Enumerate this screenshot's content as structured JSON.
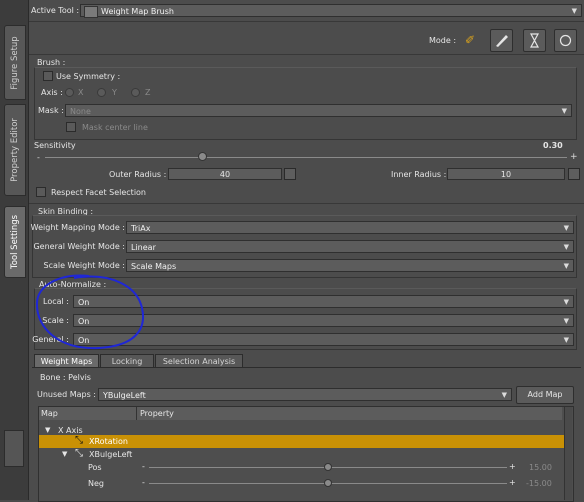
{
  "side_tabs": [
    {
      "label": "Figure Setup"
    },
    {
      "label": "Property Editor"
    },
    {
      "label": "Tool Settings"
    }
  ],
  "header": {
    "active_tool_label": "Active Tool :",
    "tool_name": "Weight Map Brush",
    "mode_label": "Mode :"
  },
  "brush": {
    "section_label": "Brush :",
    "use_symmetry_label": "Use Symmetry :",
    "axis_label": "Axis :",
    "axis_options": [
      "X",
      "Y",
      "Z"
    ],
    "mask_label": "Mask :",
    "mask_value": "None",
    "mask_center_line_label": "Mask center line"
  },
  "sensitivity": {
    "label": "Sensitivity",
    "value": "0.30",
    "level": 0.3
  },
  "radius": {
    "outer_label": "Outer Radius :",
    "outer_value": "40",
    "inner_label": "Inner Radius :",
    "inner_value": "10"
  },
  "respect_facet_label": "Respect Facet Selection",
  "skin_binding": {
    "section_label": "Skin Binding :",
    "rows": [
      {
        "label": "Weight Mapping Mode :",
        "value": "TriAx"
      },
      {
        "label": "General Weight Mode :",
        "value": "Linear"
      },
      {
        "label": "Scale Weight Mode :",
        "value": "Scale Maps"
      }
    ]
  },
  "auto_normalize": {
    "section_label": "Auto-Normalize :",
    "rows": [
      {
        "label": "Local :",
        "value": "On"
      },
      {
        "label": "Scale :",
        "value": "On"
      },
      {
        "label": "General :",
        "value": "On"
      }
    ]
  },
  "tabs": [
    "Weight Maps",
    "Locking",
    "Selection Analysis"
  ],
  "bone_label": "Bone : Pelvis",
  "unused_maps": {
    "label": "Unused Maps :",
    "value": "YBulgeLeft",
    "add_button": "Add Map"
  },
  "table": {
    "headers": [
      "Map",
      "Property"
    ],
    "rows": [
      {
        "label": "X Axis",
        "indent": 0,
        "toggle": "▼",
        "selected": false
      },
      {
        "label": "XRotation",
        "indent": 1,
        "toggle": "",
        "selected": true
      },
      {
        "label": "XBulgeLeft",
        "indent": 1,
        "toggle": "▼",
        "selected": false
      }
    ],
    "sliders": [
      {
        "label": "Pos",
        "value": "15.00",
        "level": 0.5
      },
      {
        "label": "Neg",
        "value": "-15.00",
        "level": 0.5
      }
    ]
  },
  "colors": {
    "accent": "#c99105",
    "panel": "#4c4c4c",
    "annotation": "#1f27d6"
  }
}
